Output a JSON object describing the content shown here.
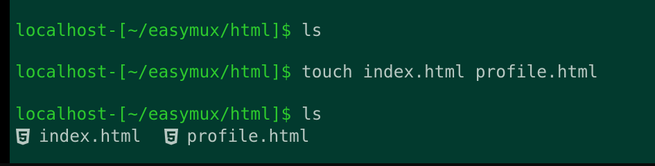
{
  "terminal": {
    "prompt": "localhost-[~/easymux/html]$ ",
    "lines": [
      {
        "command": "ls"
      },
      {
        "command": "touch index.html profile.html"
      },
      {
        "command": "ls"
      }
    ],
    "ls_output": [
      {
        "icon": "html5-icon",
        "name": "index.html"
      },
      {
        "icon": "html5-icon",
        "name": "profile.html"
      }
    ],
    "colors": {
      "background": "#023a2e",
      "prompt": "#2dc92d",
      "text": "#b7c7c1",
      "gutter": "#000000"
    }
  }
}
